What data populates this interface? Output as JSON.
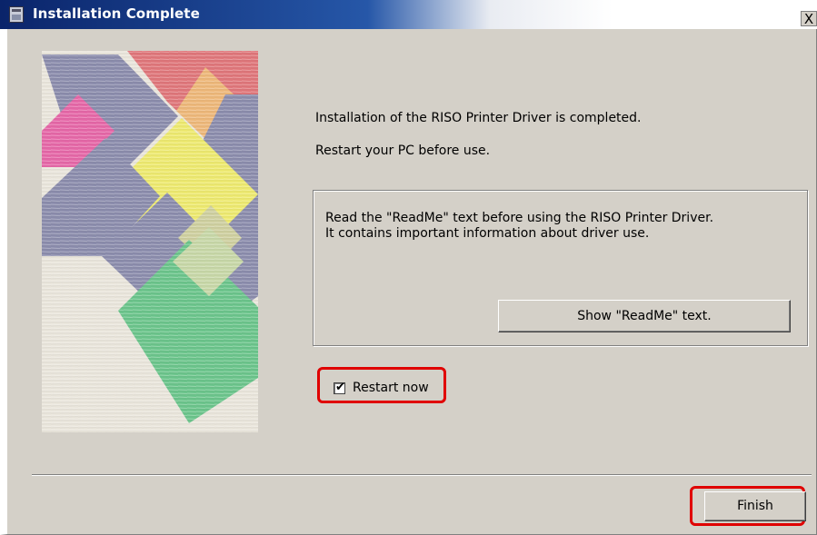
{
  "window": {
    "title": "Installation Complete",
    "close_label": "X"
  },
  "main": {
    "message_line1": "Installation of the RISO Printer Driver is completed.",
    "message_line2": "Restart your PC before use.",
    "readme_text": "Read the \"ReadMe\" text before using the RISO Printer Driver.\nIt contains important information about driver use.",
    "readme_button": "Show \"ReadMe\" text.",
    "restart_checkbox": {
      "label": "Restart now",
      "checked": true,
      "check_mark": "✔"
    }
  },
  "footer": {
    "finish_button": "Finish"
  },
  "colors": {
    "highlight": "#e00000",
    "dialog_bg": "#d4d0c8",
    "titlebar": "#0a246a"
  }
}
